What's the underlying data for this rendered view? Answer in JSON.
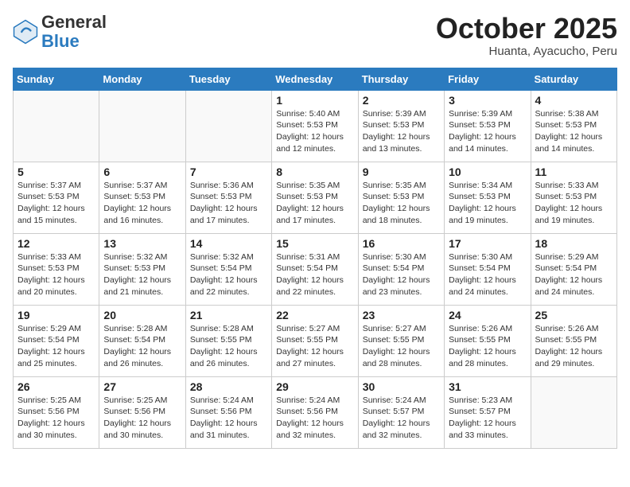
{
  "header": {
    "logo_general": "General",
    "logo_blue": "Blue",
    "month_title": "October 2025",
    "location": "Huanta, Ayacucho, Peru"
  },
  "weekdays": [
    "Sunday",
    "Monday",
    "Tuesday",
    "Wednesday",
    "Thursday",
    "Friday",
    "Saturday"
  ],
  "weeks": [
    [
      {
        "day": "",
        "detail": ""
      },
      {
        "day": "",
        "detail": ""
      },
      {
        "day": "",
        "detail": ""
      },
      {
        "day": "1",
        "detail": "Sunrise: 5:40 AM\nSunset: 5:53 PM\nDaylight: 12 hours\nand 12 minutes."
      },
      {
        "day": "2",
        "detail": "Sunrise: 5:39 AM\nSunset: 5:53 PM\nDaylight: 12 hours\nand 13 minutes."
      },
      {
        "day": "3",
        "detail": "Sunrise: 5:39 AM\nSunset: 5:53 PM\nDaylight: 12 hours\nand 14 minutes."
      },
      {
        "day": "4",
        "detail": "Sunrise: 5:38 AM\nSunset: 5:53 PM\nDaylight: 12 hours\nand 14 minutes."
      }
    ],
    [
      {
        "day": "5",
        "detail": "Sunrise: 5:37 AM\nSunset: 5:53 PM\nDaylight: 12 hours\nand 15 minutes."
      },
      {
        "day": "6",
        "detail": "Sunrise: 5:37 AM\nSunset: 5:53 PM\nDaylight: 12 hours\nand 16 minutes."
      },
      {
        "day": "7",
        "detail": "Sunrise: 5:36 AM\nSunset: 5:53 PM\nDaylight: 12 hours\nand 17 minutes."
      },
      {
        "day": "8",
        "detail": "Sunrise: 5:35 AM\nSunset: 5:53 PM\nDaylight: 12 hours\nand 17 minutes."
      },
      {
        "day": "9",
        "detail": "Sunrise: 5:35 AM\nSunset: 5:53 PM\nDaylight: 12 hours\nand 18 minutes."
      },
      {
        "day": "10",
        "detail": "Sunrise: 5:34 AM\nSunset: 5:53 PM\nDaylight: 12 hours\nand 19 minutes."
      },
      {
        "day": "11",
        "detail": "Sunrise: 5:33 AM\nSunset: 5:53 PM\nDaylight: 12 hours\nand 19 minutes."
      }
    ],
    [
      {
        "day": "12",
        "detail": "Sunrise: 5:33 AM\nSunset: 5:53 PM\nDaylight: 12 hours\nand 20 minutes."
      },
      {
        "day": "13",
        "detail": "Sunrise: 5:32 AM\nSunset: 5:53 PM\nDaylight: 12 hours\nand 21 minutes."
      },
      {
        "day": "14",
        "detail": "Sunrise: 5:32 AM\nSunset: 5:54 PM\nDaylight: 12 hours\nand 22 minutes."
      },
      {
        "day": "15",
        "detail": "Sunrise: 5:31 AM\nSunset: 5:54 PM\nDaylight: 12 hours\nand 22 minutes."
      },
      {
        "day": "16",
        "detail": "Sunrise: 5:30 AM\nSunset: 5:54 PM\nDaylight: 12 hours\nand 23 minutes."
      },
      {
        "day": "17",
        "detail": "Sunrise: 5:30 AM\nSunset: 5:54 PM\nDaylight: 12 hours\nand 24 minutes."
      },
      {
        "day": "18",
        "detail": "Sunrise: 5:29 AM\nSunset: 5:54 PM\nDaylight: 12 hours\nand 24 minutes."
      }
    ],
    [
      {
        "day": "19",
        "detail": "Sunrise: 5:29 AM\nSunset: 5:54 PM\nDaylight: 12 hours\nand 25 minutes."
      },
      {
        "day": "20",
        "detail": "Sunrise: 5:28 AM\nSunset: 5:54 PM\nDaylight: 12 hours\nand 26 minutes."
      },
      {
        "day": "21",
        "detail": "Sunrise: 5:28 AM\nSunset: 5:55 PM\nDaylight: 12 hours\nand 26 minutes."
      },
      {
        "day": "22",
        "detail": "Sunrise: 5:27 AM\nSunset: 5:55 PM\nDaylight: 12 hours\nand 27 minutes."
      },
      {
        "day": "23",
        "detail": "Sunrise: 5:27 AM\nSunset: 5:55 PM\nDaylight: 12 hours\nand 28 minutes."
      },
      {
        "day": "24",
        "detail": "Sunrise: 5:26 AM\nSunset: 5:55 PM\nDaylight: 12 hours\nand 28 minutes."
      },
      {
        "day": "25",
        "detail": "Sunrise: 5:26 AM\nSunset: 5:55 PM\nDaylight: 12 hours\nand 29 minutes."
      }
    ],
    [
      {
        "day": "26",
        "detail": "Sunrise: 5:25 AM\nSunset: 5:56 PM\nDaylight: 12 hours\nand 30 minutes."
      },
      {
        "day": "27",
        "detail": "Sunrise: 5:25 AM\nSunset: 5:56 PM\nDaylight: 12 hours\nand 30 minutes."
      },
      {
        "day": "28",
        "detail": "Sunrise: 5:24 AM\nSunset: 5:56 PM\nDaylight: 12 hours\nand 31 minutes."
      },
      {
        "day": "29",
        "detail": "Sunrise: 5:24 AM\nSunset: 5:56 PM\nDaylight: 12 hours\nand 32 minutes."
      },
      {
        "day": "30",
        "detail": "Sunrise: 5:24 AM\nSunset: 5:57 PM\nDaylight: 12 hours\nand 32 minutes."
      },
      {
        "day": "31",
        "detail": "Sunrise: 5:23 AM\nSunset: 5:57 PM\nDaylight: 12 hours\nand 33 minutes."
      },
      {
        "day": "",
        "detail": ""
      }
    ]
  ]
}
